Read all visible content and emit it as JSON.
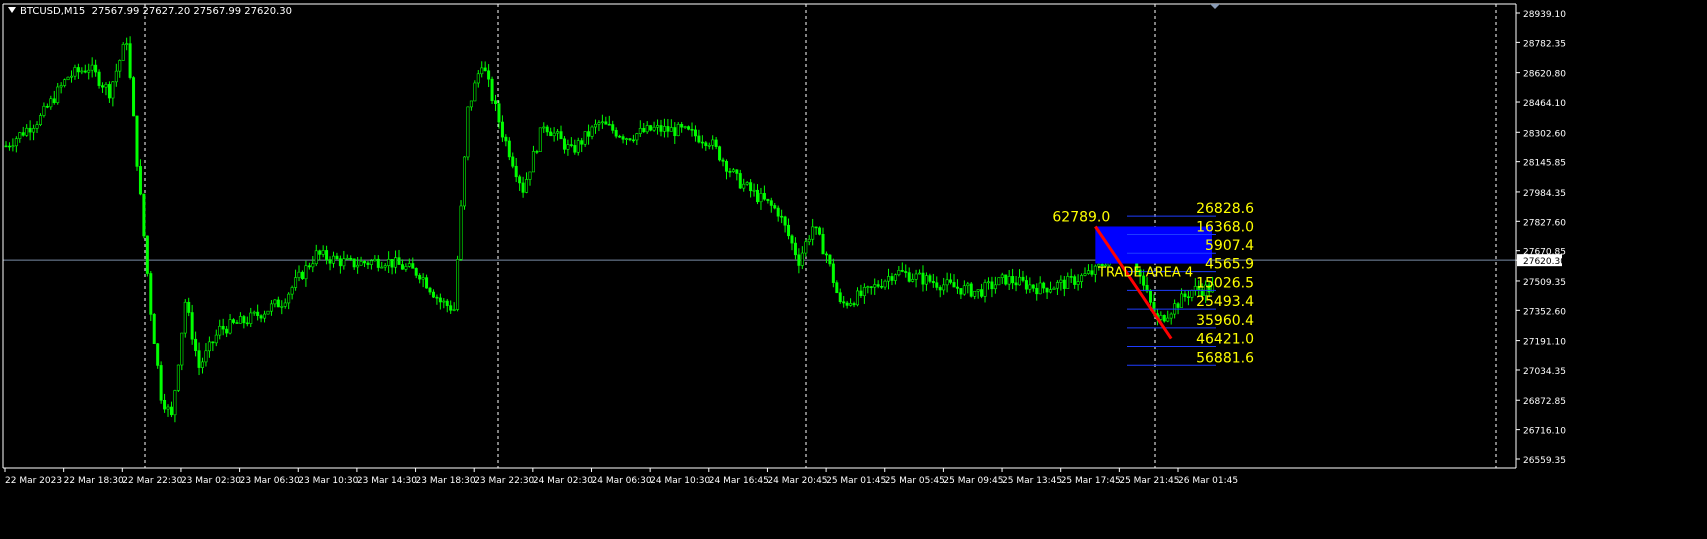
{
  "header": {
    "symbol": "BTCUSD,M15",
    "ohlc": "27567.99 27627.20 27567.99 27620.30"
  },
  "colors": {
    "background": "#000000",
    "candle": "#00FF00",
    "fib": "#FFFF00",
    "zone": "#0000FF",
    "trend_line": "#FF0000",
    "level_line": "#1E3CFF",
    "price_line": "#7A8CA6",
    "axis_text": "#FFFFFF"
  },
  "chart_data": {
    "type": "candlestick",
    "symbol": "BTCUSD",
    "timeframe": "M15",
    "ylim": [
      26559.35,
      28939.1
    ],
    "y_ticks": [
      "28939.10",
      "28782.35",
      "28620.80",
      "28464.10",
      "28302.60",
      "28145.85",
      "27984.35",
      "27827.60",
      "27670.85",
      "27620.30",
      "27509.35",
      "27352.60",
      "27191.10",
      "27034.35",
      "26872.85",
      "26716.10",
      "26559.35"
    ],
    "x_ticks": [
      "22 Mar 2023",
      "22 Mar 18:30",
      "22 Mar 22:30",
      "23 Mar 02:30",
      "23 Mar 06:30",
      "23 Mar 10:30",
      "23 Mar 14:30",
      "23 Mar 18:30",
      "23 Mar 22:30",
      "24 Mar 02:30",
      "24 Mar 06:30",
      "24 Mar 10:30",
      "24 Mar 16:45",
      "24 Mar 20:45",
      "25 Mar 01:45",
      "25 Mar 05:45",
      "25 Mar 09:45",
      "25 Mar 13:45",
      "25 Mar 17:45",
      "25 Mar 21:45",
      "26 Mar 01:45"
    ],
    "current_price": 27620.3,
    "close_path": [
      [
        0,
        28230
      ],
      [
        10,
        28380
      ],
      [
        18,
        28600
      ],
      [
        24,
        28650
      ],
      [
        30,
        28520
      ],
      [
        35,
        28800
      ],
      [
        38,
        28150
      ],
      [
        42,
        27350
      ],
      [
        45,
        26900
      ],
      [
        48,
        26780
      ],
      [
        52,
        27400
      ],
      [
        56,
        27050
      ],
      [
        62,
        27250
      ],
      [
        70,
        27300
      ],
      [
        80,
        27400
      ],
      [
        90,
        27650
      ],
      [
        100,
        27600
      ],
      [
        110,
        27620
      ],
      [
        120,
        27550
      ],
      [
        126,
        27400
      ],
      [
        130,
        27360
      ],
      [
        134,
        28420
      ],
      [
        138,
        28680
      ],
      [
        144,
        28300
      ],
      [
        150,
        28000
      ],
      [
        156,
        28350
      ],
      [
        164,
        28200
      ],
      [
        172,
        28350
      ],
      [
        180,
        28280
      ],
      [
        188,
        28320
      ],
      [
        196,
        28310
      ],
      [
        204,
        28260
      ],
      [
        212,
        28050
      ],
      [
        218,
        27960
      ],
      [
        224,
        27880
      ],
      [
        230,
        27620
      ],
      [
        234,
        27800
      ],
      [
        238,
        27650
      ],
      [
        242,
        27380
      ],
      [
        250,
        27450
      ],
      [
        258,
        27560
      ],
      [
        266,
        27520
      ],
      [
        274,
        27480
      ],
      [
        282,
        27450
      ],
      [
        290,
        27520
      ],
      [
        300,
        27470
      ],
      [
        308,
        27500
      ],
      [
        316,
        27560
      ],
      [
        322,
        27680
      ],
      [
        326,
        27700
      ],
      [
        330,
        27480
      ],
      [
        334,
        27290
      ],
      [
        338,
        27360
      ],
      [
        344,
        27460
      ],
      [
        350,
        27470
      ]
    ],
    "fib_levels": [
      {
        "label": "26828.6",
        "price": 27898
      },
      {
        "label": "16368.0",
        "price": 27800
      },
      {
        "label": "5907.4",
        "price": 27700
      },
      {
        "label": "4565.9",
        "price": 27602
      },
      {
        "label": "15026.5",
        "price": 27502
      },
      {
        "label": "25493.4",
        "price": 27402
      },
      {
        "label": "35960.4",
        "price": 27302
      },
      {
        "label": "46421.0",
        "price": 27202
      },
      {
        "label": "56881.6",
        "price": 27102
      }
    ],
    "trend_line": {
      "from_index": 316,
      "from_price": 27800,
      "to_index": 338,
      "to_price": 27202,
      "label": "62789.0"
    },
    "zone": {
      "label": "TRADE AREA 4",
      "top": 27800,
      "bottom": 27602
    }
  }
}
